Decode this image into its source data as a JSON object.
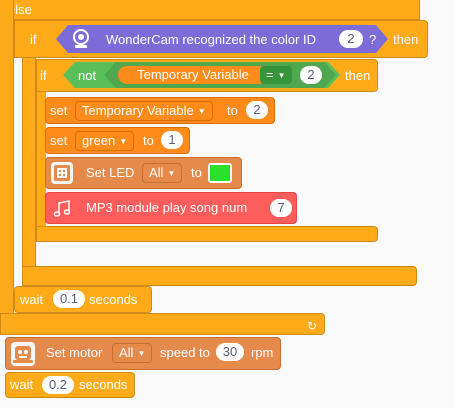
{
  "else_block": {
    "label": "else"
  },
  "if_outer": {
    "keyword": "if",
    "condition_text": "WonderCam recognized the color ID",
    "color_id": "2",
    "qmark": "?",
    "then": "then"
  },
  "if_inner": {
    "keyword": "if",
    "not": "not",
    "variable": "Temporary Variable",
    "operator": "=",
    "value": "2",
    "then": "then"
  },
  "set_var": {
    "set": "set",
    "variable": "Temporary Variable",
    "to": "to",
    "value": "2"
  },
  "set_green": {
    "set": "set",
    "variable": "green",
    "to": "to",
    "value": "1"
  },
  "set_led": {
    "label": "Set LED",
    "target": "All",
    "to": "to",
    "color": "#2be02b"
  },
  "mp3": {
    "label": "MP3 module play song num",
    "value": "7"
  },
  "wait1": {
    "label": "wait",
    "value": "0.1",
    "unit": "seconds"
  },
  "loop_arrow": "↻",
  "motor": {
    "label": "Set motor",
    "target": "All",
    "speed_label": "speed to",
    "value": "30",
    "unit": "rpm"
  },
  "wait2": {
    "label": "wait",
    "value": "0.2",
    "unit": "seconds"
  },
  "colors": {
    "control": "#ffab19",
    "sensing": "#7d6bd8",
    "operator": "#59c059",
    "variable": "#ff8c1a",
    "sound": "#ff5c5c",
    "extension": "#e58a4b"
  }
}
